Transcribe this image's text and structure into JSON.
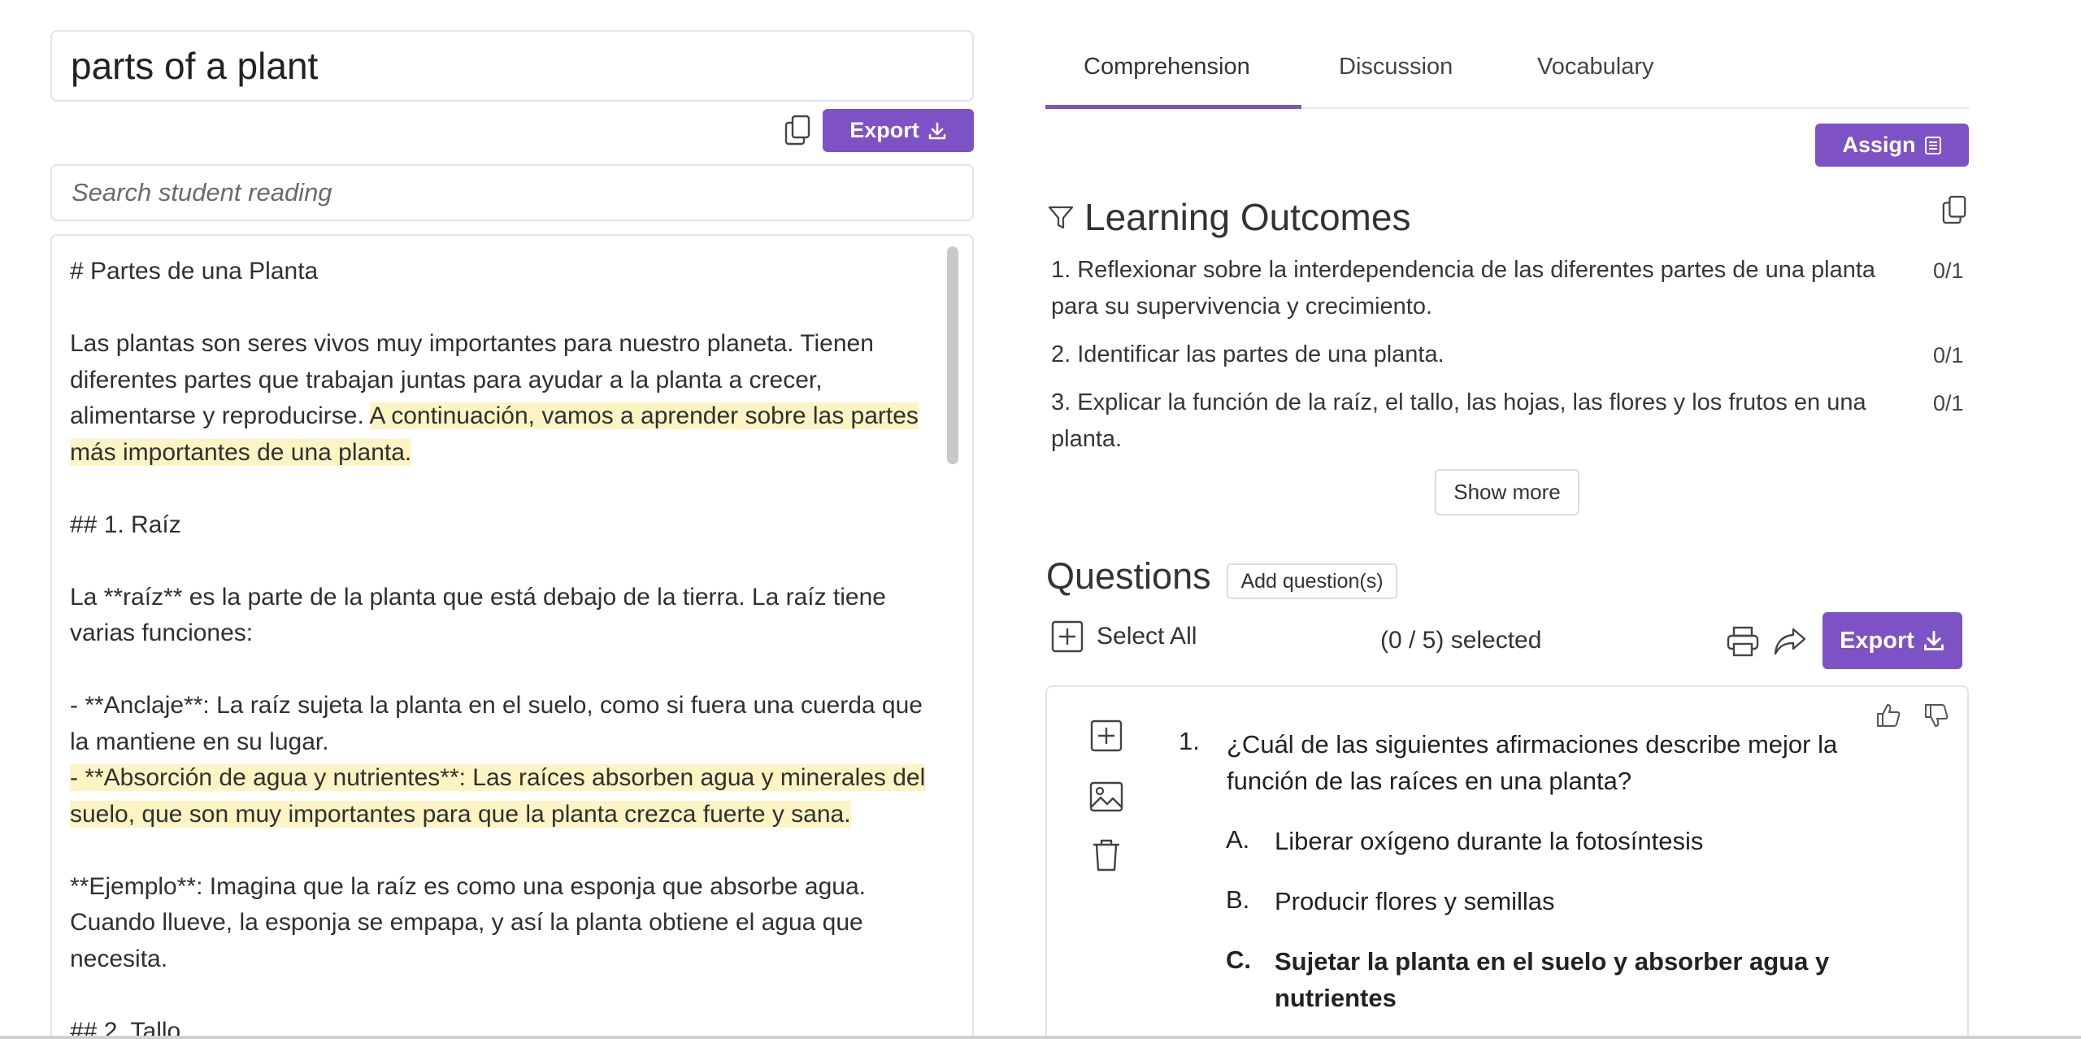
{
  "topic": {
    "value": "parts of a plant"
  },
  "reading_toolbar": {
    "export_label": "Export"
  },
  "search": {
    "placeholder": "Search student reading"
  },
  "reading": {
    "lines": [
      "# Partes de una Planta",
      "Las plantas son seres vivos muy importantes para nuestro planeta. Tienen diferentes partes que trabajan juntas para ayudar a la planta a crecer, alimentarse y reproducirse.",
      "A continuación, vamos a aprender sobre las partes más importantes de una planta.",
      "## 1. Raíz",
      "La **raíz** es la parte de la planta que está debajo de la tierra. La raíz tiene varias funciones:",
      "- **Anclaje**: La raíz sujeta la planta en el suelo, como si fuera una cuerda que la mantiene en su lugar.",
      "- **Absorción de agua y nutrientes**: Las raíces absorben agua y minerales del suelo, que son muy importantes para que la planta crezca fuerte y sana.",
      "**Ejemplo**: Imagina que la raíz es como una esponja que absorbe agua. Cuando llueve, la esponja se empapa, y así la planta obtiene el agua que necesita.",
      "## 2. Tallo"
    ]
  },
  "tabs": [
    {
      "label": "Comprehension",
      "active": true
    },
    {
      "label": "Discussion",
      "active": false
    },
    {
      "label": "Vocabulary",
      "active": false
    }
  ],
  "assign": {
    "label": "Assign"
  },
  "learning_outcomes": {
    "title": "Learning Outcomes",
    "items": [
      {
        "text": "1. Reflexionar sobre la interdependencia de las diferentes partes de una planta para su supervivencia y crecimiento.",
        "score": "0/1"
      },
      {
        "text": "2. Identificar las partes de una planta.",
        "score": "0/1"
      },
      {
        "text": "3. Explicar la función de la raíz, el tallo, las hojas, las flores y los frutos en una planta.",
        "score": "0/1"
      }
    ],
    "show_more": "Show more"
  },
  "questions": {
    "title": "Questions",
    "add_label": "Add question(s)",
    "select_all": "Select All",
    "selected": "(0 / 5) selected",
    "export_label": "Export",
    "items": [
      {
        "number": "1.",
        "text": "¿Cuál de las siguientes afirmaciones describe mejor la función de las raíces en una planta?",
        "options": [
          {
            "letter": "A.",
            "text": "Liberar oxígeno durante la fotosíntesis",
            "correct": false
          },
          {
            "letter": "B.",
            "text": "Producir flores y semillas",
            "correct": false
          },
          {
            "letter": "C.",
            "text": "Sujetar la planta en el suelo y absorber agua y nutrientes",
            "correct": true
          }
        ]
      }
    ]
  },
  "colors": {
    "accent": "#7d52c4",
    "highlight": "#fdf4c4"
  },
  "icons": [
    "copy-icon",
    "download-icon",
    "filter-icon",
    "list-icon",
    "plus-square-icon",
    "print-icon",
    "share-icon",
    "thumbs-up-icon",
    "thumbs-down-icon",
    "image-icon",
    "trash-icon"
  ]
}
